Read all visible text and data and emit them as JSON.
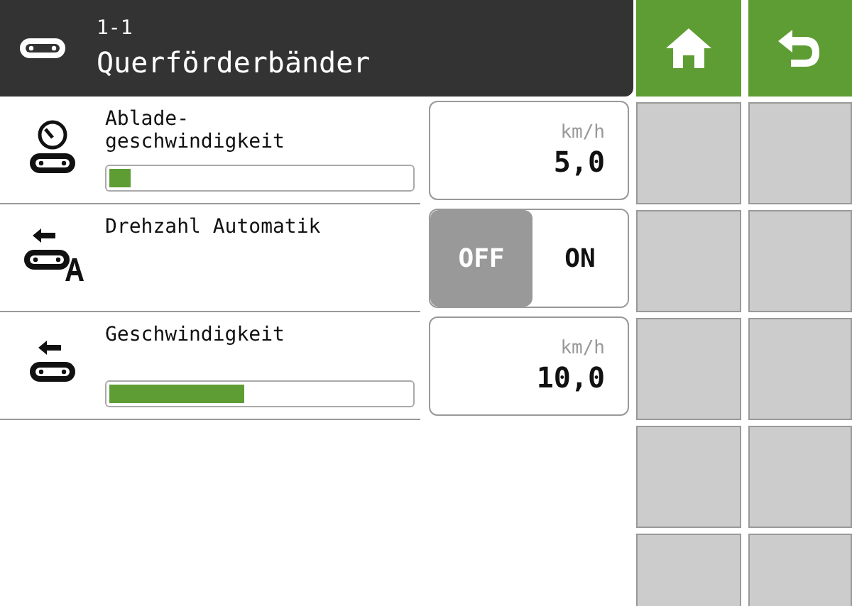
{
  "header": {
    "number": "1-1",
    "title": "Querförderbänder"
  },
  "rows": [
    {
      "kind": "slider",
      "label": "Ablade-\ngeschwindigkeit",
      "level": 0.07,
      "unit": "km/h",
      "value": "5,0"
    },
    {
      "kind": "toggle",
      "label": "Drehzahl Automatik",
      "options": [
        {
          "label": "OFF",
          "selected": true
        },
        {
          "label": "ON",
          "selected": false
        }
      ]
    },
    {
      "kind": "slider",
      "label": "Geschwindigkeit",
      "level": 0.45,
      "unit": "km/h",
      "value": "10,0"
    }
  ]
}
